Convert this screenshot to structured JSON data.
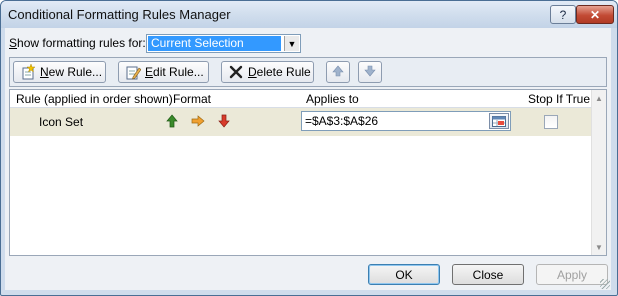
{
  "window": {
    "title": "Conditional Formatting Rules Manager",
    "help_glyph": "?",
    "close_glyph": "✕"
  },
  "show_rules": {
    "label_prefix": "",
    "label_accel": "S",
    "label_rest": "how formatting rules for:",
    "selected": "Current Selection"
  },
  "toolbar": {
    "new_rule_accel": "N",
    "new_rule_rest": "ew Rule...",
    "edit_rule_accel": "E",
    "edit_rule_rest": "dit Rule...",
    "delete_rule_accel": "D",
    "delete_rule_rest": "elete Rule"
  },
  "table": {
    "columns": [
      "Rule (applied in order shown)",
      "Format",
      "Applies to",
      "Stop If True"
    ],
    "rows": [
      {
        "rule": "Icon Set",
        "format_icons": [
          "up-arrow-green",
          "right-arrow-yellow",
          "down-arrow-red"
        ],
        "applies_to": "=$A$3:$A$26",
        "stop_if_true": false
      }
    ]
  },
  "buttons": {
    "ok": "OK",
    "close": "Close",
    "apply": "Apply"
  },
  "colors": {
    "title_bar": "#d2dfee",
    "selected_row": "#ebe9d8",
    "selection_highlight": "#3399ff",
    "up_arrow": "#3a8a2a",
    "right_arrow": "#f0a030",
    "down_arrow": "#d83b2b"
  }
}
